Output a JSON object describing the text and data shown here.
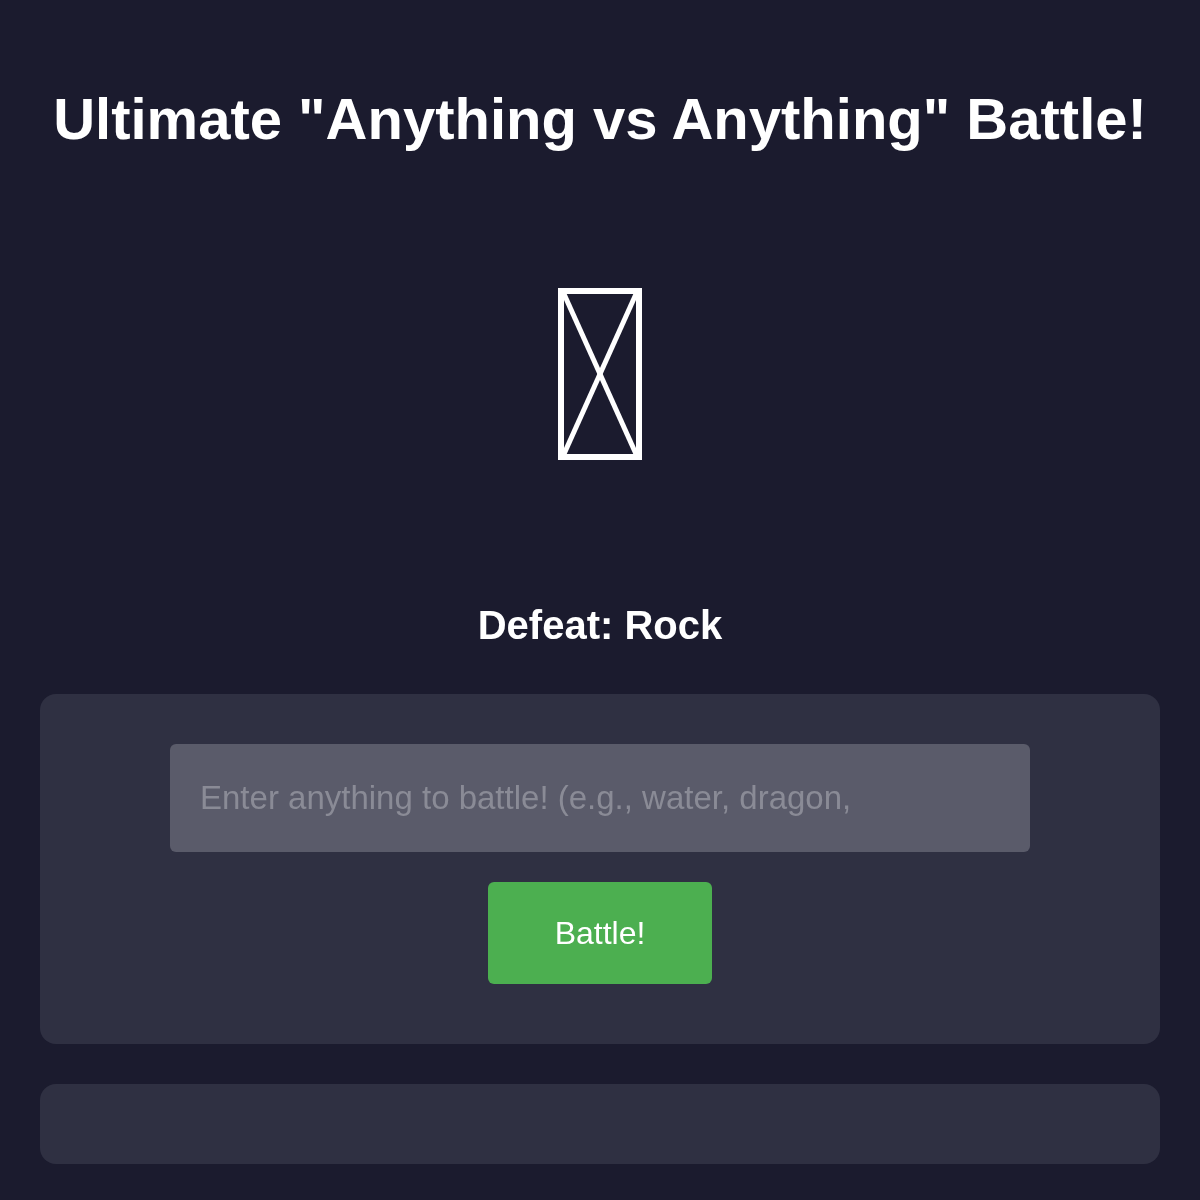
{
  "title": "Ultimate \"Anything vs Anything\" Battle!",
  "opponent": {
    "label": "Defeat: Rock"
  },
  "battle_form": {
    "placeholder": "Enter anything to battle! (e.g., water, dragon,",
    "button": "Battle!"
  }
}
